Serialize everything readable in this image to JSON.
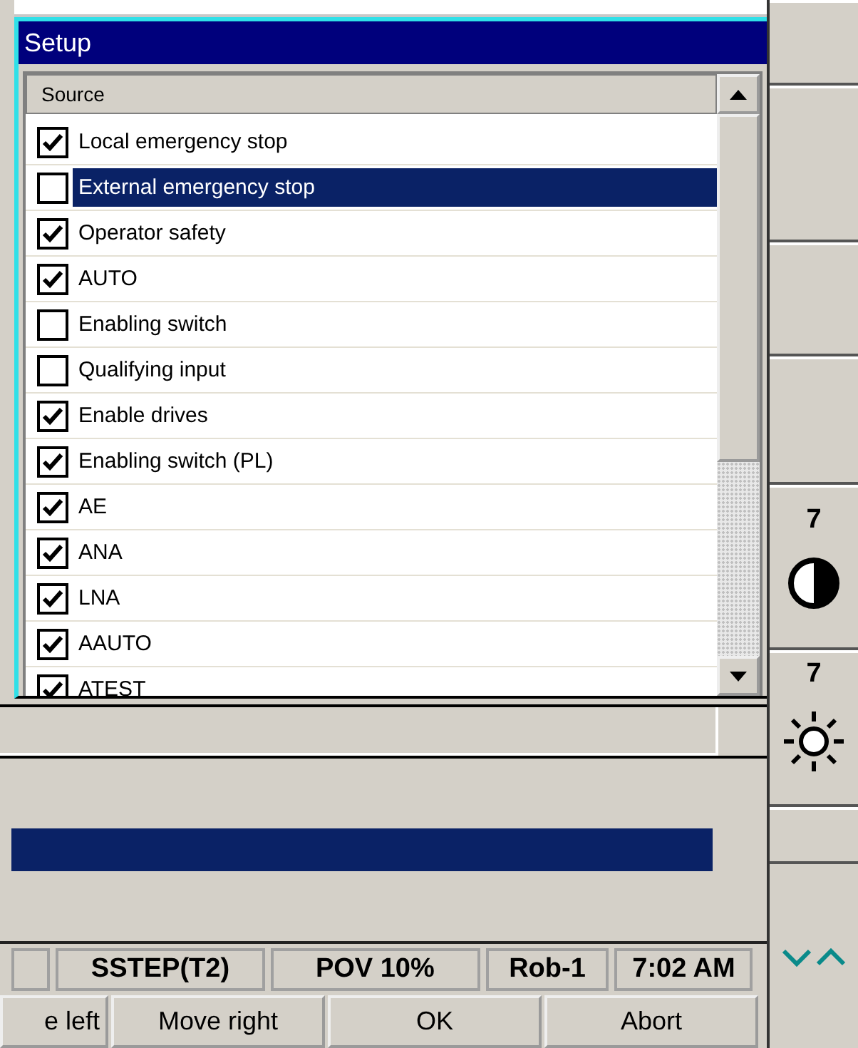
{
  "window": {
    "title": "Setup"
  },
  "list": {
    "column": "Source",
    "rows": [
      {
        "label": "Local emergency stop",
        "checked": true,
        "selected": false
      },
      {
        "label": "External emergency stop",
        "checked": false,
        "selected": true
      },
      {
        "label": "Operator safety",
        "checked": true,
        "selected": false
      },
      {
        "label": "AUTO",
        "checked": true,
        "selected": false
      },
      {
        "label": "Enabling switch",
        "checked": false,
        "selected": false
      },
      {
        "label": "Qualifying input",
        "checked": false,
        "selected": false
      },
      {
        "label": "Enable drives",
        "checked": true,
        "selected": false
      },
      {
        "label": "Enabling switch (PL)",
        "checked": true,
        "selected": false
      },
      {
        "label": "AE",
        "checked": true,
        "selected": false
      },
      {
        "label": "ANA",
        "checked": true,
        "selected": false
      },
      {
        "label": "LNA",
        "checked": true,
        "selected": false
      },
      {
        "label": "AAUTO",
        "checked": true,
        "selected": false
      },
      {
        "label": "ATEST",
        "checked": true,
        "selected": false
      }
    ]
  },
  "status_bar": [
    "SSTEP(T2)",
    "POV 10%",
    "Rob-1",
    "7:02 AM"
  ],
  "buttons": [
    "e left",
    "Move right",
    "OK",
    "Abort"
  ],
  "side_panel": {
    "contrast": "7",
    "brightness": "7"
  }
}
